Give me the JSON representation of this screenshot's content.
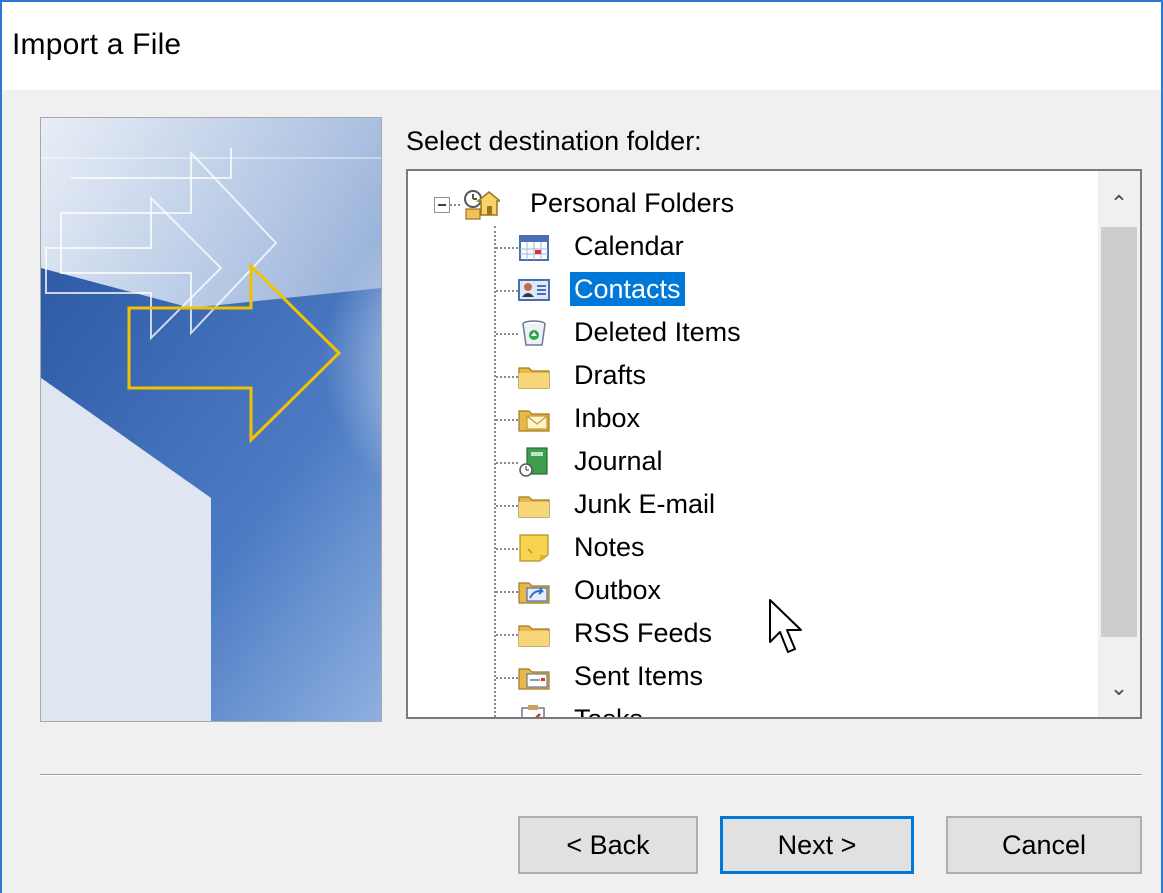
{
  "window": {
    "title": "Import a File"
  },
  "content": {
    "prompt": "Select destination folder:"
  },
  "tree": {
    "root": {
      "label": "Personal Folders",
      "icon": "personal-folders-icon",
      "expanded": true
    },
    "items": [
      {
        "label": "Calendar",
        "icon": "calendar-icon",
        "selected": false
      },
      {
        "label": "Contacts",
        "icon": "contacts-icon",
        "selected": true
      },
      {
        "label": "Deleted Items",
        "icon": "deleted-items-icon",
        "selected": false
      },
      {
        "label": "Drafts",
        "icon": "folder-icon",
        "selected": false
      },
      {
        "label": "Inbox",
        "icon": "inbox-icon",
        "selected": false
      },
      {
        "label": "Journal",
        "icon": "journal-icon",
        "selected": false
      },
      {
        "label": "Junk E-mail",
        "icon": "folder-icon",
        "selected": false
      },
      {
        "label": "Notes",
        "icon": "notes-icon",
        "selected": false
      },
      {
        "label": "Outbox",
        "icon": "outbox-icon",
        "selected": false
      },
      {
        "label": "RSS Feeds",
        "icon": "folder-icon",
        "selected": false
      },
      {
        "label": "Sent Items",
        "icon": "sent-items-icon",
        "selected": false
      },
      {
        "label": "Tasks",
        "icon": "tasks-icon",
        "selected": false
      }
    ]
  },
  "buttons": {
    "back": "< Back",
    "next": "Next >",
    "cancel": "Cancel"
  },
  "colors": {
    "accent": "#0078d7",
    "window_border": "#2b79d6",
    "dialog_bg": "#f0f0f0"
  }
}
